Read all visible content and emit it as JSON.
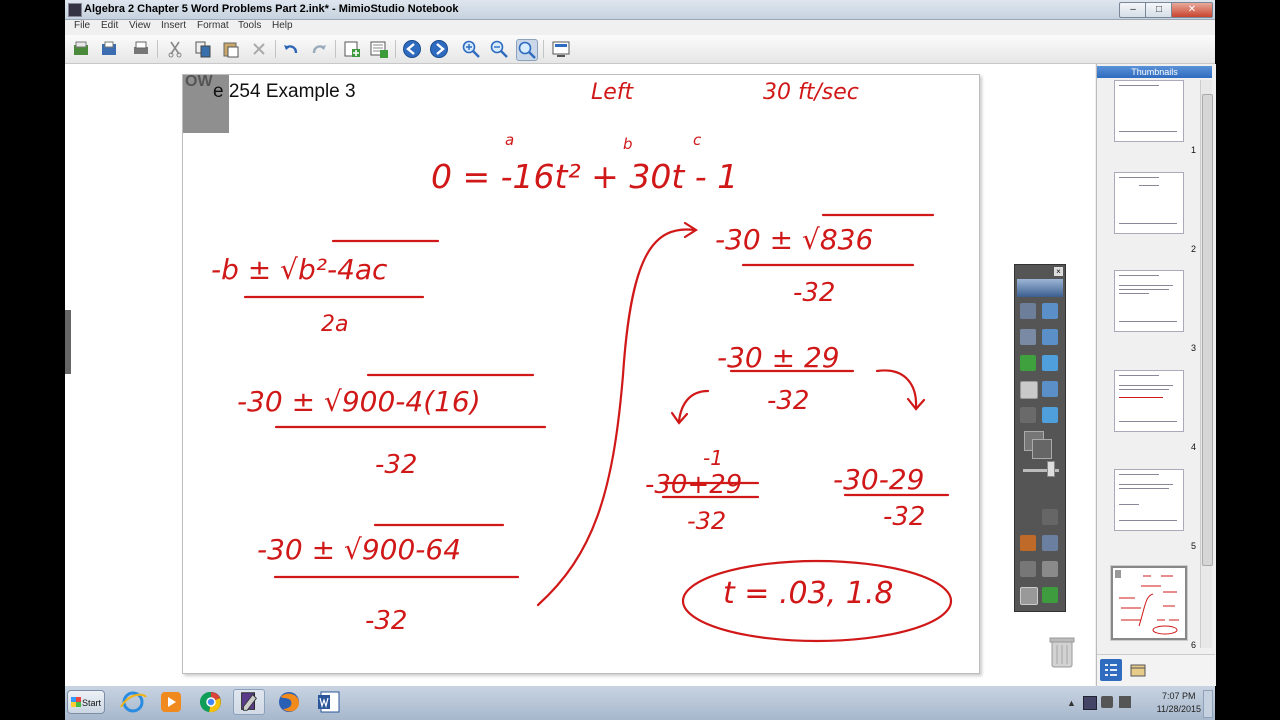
{
  "window": {
    "title": "Algebra 2 Chapter 5 Word Problems Part 2.ink* - MimioStudio Notebook",
    "minimize": "–",
    "maximize": "□",
    "close": "✕"
  },
  "menu": [
    "File",
    "Edit",
    "View",
    "Insert",
    "Format",
    "Tools",
    "Help"
  ],
  "toolbar_icons": [
    "new-page-icon",
    "open-icon",
    "print-icon",
    "cut-icon",
    "copy-icon",
    "paste-icon",
    "delete-icon",
    "undo-icon",
    "redo-icon",
    "add-page-icon",
    "add-page-alt-icon",
    "back-icon",
    "forward-icon",
    "zoom-in-icon",
    "zoom-out-icon",
    "zoom-fit-icon",
    "screen-icon"
  ],
  "page": {
    "tab_text": "OW",
    "heading": "e 254 Example 3",
    "ink": {
      "left": "Left",
      "speed": "30 ft/sec",
      "label_a": "a",
      "label_b": "b",
      "label_c": "c",
      "equation": "0 = -16t² + 30t - 1",
      "formula_top": "-b ± √b²-4ac",
      "formula_bottom": "2a",
      "step1_top": "-30 ± √900-4(16)",
      "step1_bottom": "-32",
      "step2_top": "-30 ± √900-64",
      "step2_bottom": "-32",
      "step3_top": "-30 ± √836",
      "step3_bottom": "-32",
      "step4_top": "-30 ± 29",
      "step4_bottom": "-32",
      "left_case_note": "-1",
      "left_case_top": "-30+29",
      "left_case_bottom": "-32",
      "right_case_top": "-30-29",
      "right_case_bottom": "-32",
      "answer": "t = .03, 1.8"
    }
  },
  "thumbnails": {
    "header": "Thumbnails",
    "pages": [
      "1",
      "2",
      "3",
      "4",
      "5",
      "6"
    ]
  },
  "taskbar": {
    "start": "Start",
    "apps": [
      "ie-icon",
      "media-player-icon",
      "chrome-icon",
      "mimio-icon",
      "firefox-icon",
      "word-icon"
    ],
    "time": "7:07 PM",
    "date": "11/28/2015"
  },
  "colors": {
    "ink": "#d01818",
    "thumb_header": "#2f6bbf",
    "palette": "#555555"
  }
}
